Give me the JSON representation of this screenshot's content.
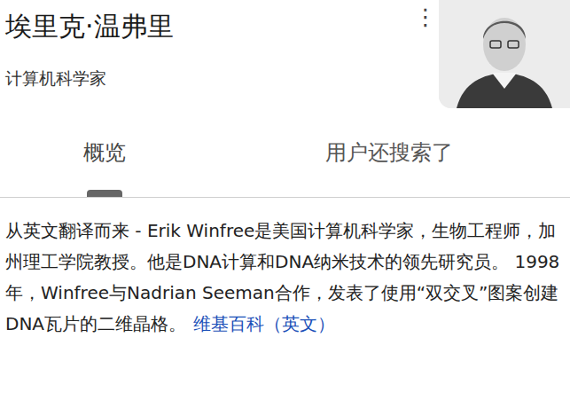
{
  "header": {
    "title": "埃里克·温弗里",
    "subtitle": "计算机科学家",
    "menu_icon": "⋮"
  },
  "tabs": [
    {
      "label": "概览",
      "selected": true
    },
    {
      "label": "用户还搜索了",
      "selected": false
    }
  ],
  "description": {
    "text": "从英文翻译而来 - Erik Winfree是美国计算机科学家，生物工程师，加州理工学院教授。他是DNA计算和DNA纳米技术的领先研究员。 1998年，Winfree与Nadrian Seeman合作，发表了使用“双交叉”图案创建DNA瓦片的二维晶格。",
    "link": "维基百科（英文）"
  }
}
